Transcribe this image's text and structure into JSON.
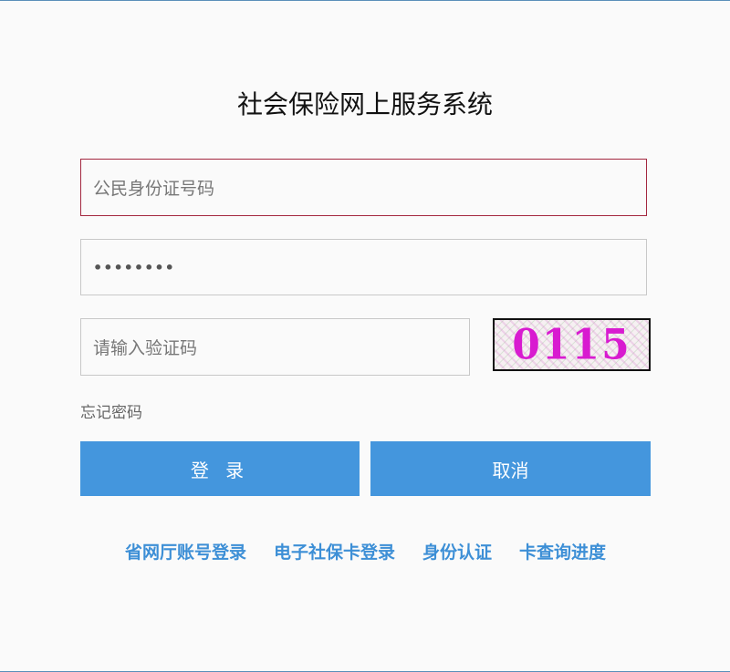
{
  "page": {
    "title": "社会保险网上服务系统"
  },
  "form": {
    "id_placeholder": "公民身份证号码",
    "password_value": "••••••••",
    "captcha_placeholder": "请输入验证码",
    "captcha_image_text": "0115",
    "forgot_label": "忘记密码"
  },
  "buttons": {
    "login_label": "登 录",
    "cancel_label": "取消"
  },
  "links": [
    "省网厅账号登录",
    "电子社保卡登录",
    "身份认证",
    "卡查询进度"
  ],
  "colors": {
    "button_bg": "#4496dd",
    "link": "#3d8fd6",
    "focus_border": "#a3273f",
    "captcha_text": "#d81bd0"
  }
}
